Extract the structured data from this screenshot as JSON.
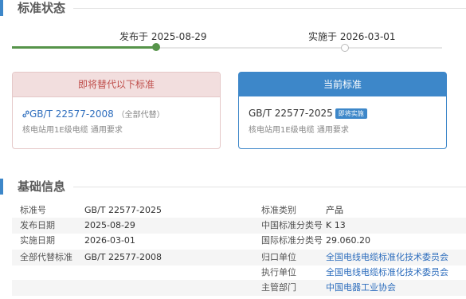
{
  "status_section": {
    "title": "标准状态",
    "timeline": {
      "published_label": "发布于 2025-08-29",
      "effective_label": "实施于 2026-03-01"
    },
    "replaced_card": {
      "header": "即将替代以下标准",
      "std_number": "GB/T 22577-2008",
      "note": "（全部代替）",
      "description": "核电站用1E级电缆 通用要求"
    },
    "current_card": {
      "header": "当前标准",
      "std_number": "GB/T 22577-2025",
      "badge": "即将实施",
      "description": "核电站用1E级电缆 通用要求"
    }
  },
  "basic_section": {
    "title": "基础信息",
    "left_rows": [
      {
        "label": "标准号",
        "value": "GB/T 22577-2025"
      },
      {
        "label": "发布日期",
        "value": "2025-08-29"
      },
      {
        "label": "实施日期",
        "value": "2026-03-01"
      },
      {
        "label": "全部代替标准",
        "value": "GB/T 22577-2008"
      }
    ],
    "right_rows": [
      {
        "label": "标准类别",
        "value": "产品"
      },
      {
        "label": "中国标准分类号",
        "value": "K 13"
      },
      {
        "label": "国际标准分类号",
        "value": "29.060.20"
      },
      {
        "label": "归口单位",
        "value": "全国电线电缆标准化技术委员会"
      },
      {
        "label": "执行单位",
        "value": "全国电线电缆标准化技术委员会"
      },
      {
        "label": "主管部门",
        "value": "中国电器工业协会"
      }
    ]
  },
  "colors": {
    "accent": "#3d87c9",
    "success": "#56944a",
    "danger_bg": "#f2dede",
    "danger_text": "#c0504d",
    "link": "#2d6dbd"
  }
}
